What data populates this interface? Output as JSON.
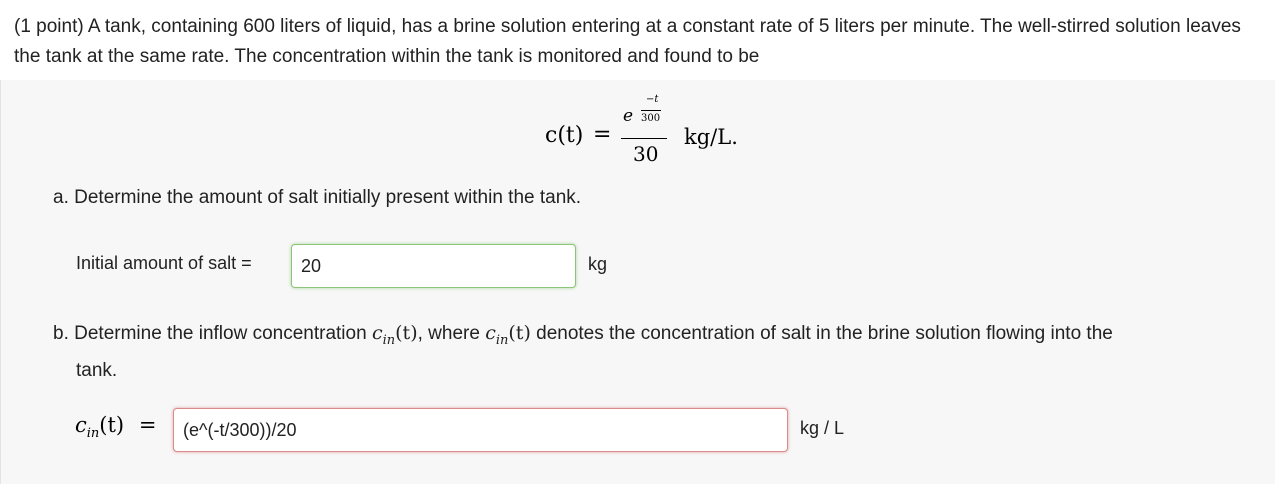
{
  "problem": {
    "intro": "(1 point) A tank, containing 600 liters of liquid, has a brine solution entering at a constant rate of 5 liters per minute. The well-stirred solution leaves the tank at the same rate. The concentration within the tank is monitored and found to be",
    "equation": {
      "lhs": "c(t)",
      "equals": "=",
      "numerator_base": "e",
      "exponent_numerator": "−t",
      "exponent_denominator": "300",
      "denominator": "30",
      "unit": "kg/L."
    }
  },
  "part_a": {
    "question": "a. Determine the amount of salt initially present within the tank.",
    "label": "Initial amount of salt =",
    "value": "20",
    "unit": "kg"
  },
  "part_b": {
    "question_prefix": "b. Determine the inflow concentration",
    "question_middle": ", where",
    "question_suffix": "denotes the concentration of salt in the brine solution flowing into the",
    "question_end": "tank.",
    "cin_symbol": "c",
    "cin_sub": "in",
    "cin_arg": "(t)",
    "equals": "=",
    "value": "(e^(-t/300))/20",
    "unit": "kg / L"
  }
}
